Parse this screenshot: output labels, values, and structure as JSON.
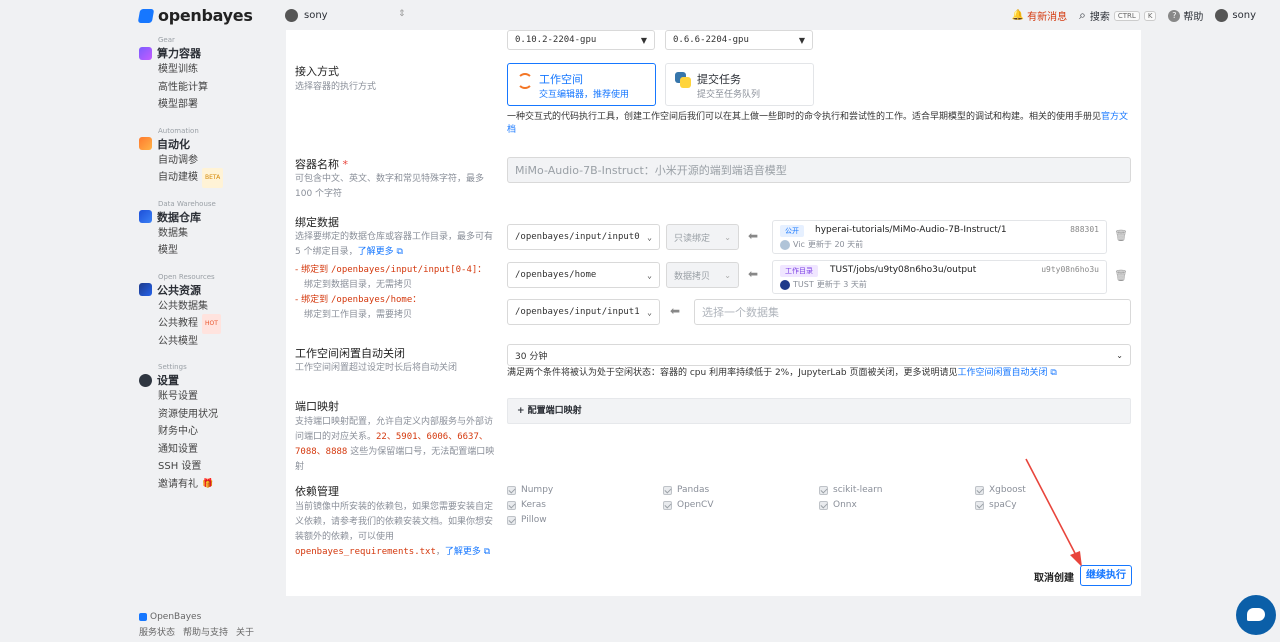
{
  "header": {
    "brand": "openbayes",
    "user": "sony",
    "news_label": "有新消息",
    "search_label": "搜索",
    "kbd": [
      "CTRL",
      "K"
    ],
    "help_label": "帮助",
    "account": "sony"
  },
  "sidebar": {
    "sections": [
      {
        "en": "Gear",
        "title": "算力容器",
        "items": [
          "模型训练",
          "高性能计算",
          "模型部署"
        ]
      },
      {
        "en": "Automation",
        "title": "自动化",
        "items": [
          "自动调参",
          "自动建模"
        ],
        "badge": "BETA"
      },
      {
        "en": "Data Warehouse",
        "title": "数据仓库",
        "items": [
          "数据集",
          "模型"
        ]
      },
      {
        "en": "Open Resources",
        "title": "公共资源",
        "items": [
          "公共数据集",
          "公共教程",
          "公共模型"
        ],
        "badge": "HOT"
      },
      {
        "en": "Settings",
        "title": "设置",
        "items": [
          "账号设置",
          "资源使用状况",
          "财务中心",
          "通知设置",
          "SSH 设置",
          "邀请有礼"
        ]
      }
    ]
  },
  "footer": {
    "brand": "OpenBayes",
    "links": [
      "服务状态",
      "帮助与支持",
      "关于"
    ]
  },
  "form": {
    "image_selects": [
      "0.10.2-2204-gpu",
      "0.6.6-2204-gpu"
    ],
    "access": {
      "label": "接入方式",
      "desc": "选择容器的执行方式",
      "options": [
        {
          "title": "工作空间",
          "sub": "交互编辑器，推荐使用"
        },
        {
          "title": "提交任务",
          "sub": "提交至任务队列"
        }
      ],
      "note": "一种交互式的代码执行工具，创建工作空间后我们可以在其上做一些即时的命令执行和尝试性的工作。适合早期模型的调试和构建。相关的使用手册见",
      "note_link": "官方文档"
    },
    "name": {
      "label": "容器名称",
      "desc": "可包含中文、英文、数字和常见特殊字符，最多 100 个字符",
      "value": "MiMo-Audio-7B-Instruct：小米开源的端到端语音模型"
    },
    "bind": {
      "label": "绑定数据",
      "desc": "选择要绑定的数据仓库或容器工作目录，最多可有 5 个绑定目录，",
      "desc_link": "了解更多",
      "rule1_pre": "- 绑定到 ",
      "rule1_path": "/openbayes/input/input[0-4]",
      "rule1_post": "：",
      "rule1_sub": "绑定到数据目录，无需拷贝",
      "rule2_pre": "- 绑定到 ",
      "rule2_path": "/openbayes/home",
      "rule2_post": "：",
      "rule2_sub": "绑定到工作目录，需要拷贝",
      "rows": [
        {
          "path": "/openbayes/input/input0",
          "mode": "只读绑定",
          "badge": "公开",
          "source": "hyperai-tutorials/MiMo-Audio-7B-Instruct/1",
          "id": "888301",
          "owner": "Vic",
          "updated": "更新于 20 天前"
        },
        {
          "path": "/openbayes/home",
          "mode": "数据拷贝",
          "badge": "工作目录",
          "source": "TUST/jobs/u9ty08n6ho3u/output",
          "id": "u9ty08n6ho3u",
          "owner": "TUST",
          "updated": "更新于 3 天前"
        },
        {
          "path": "/openbayes/input/input1",
          "placeholder": "选择一个数据集"
        }
      ]
    },
    "idle": {
      "label": "工作空间闲置自动关闭",
      "desc": "工作空间闲置超过设定时长后将自动关闭",
      "value": "30 分钟",
      "note": "满足两个条件将被认为处于空闲状态：容器的 cpu 利用率持续低于 2%，JupyterLab 页面被关闭，更多说明请见",
      "note_link": "工作空间闲置自动关闭"
    },
    "ports": {
      "label": "端口映射",
      "desc_pre": "支持端口映射配置，允许自定义内部服务与外部访问端口的对应关系。",
      "reserved": "22、5901、6006、6637、7088、8888",
      "desc_post": " 这些为保留端口号，无法配置端口映射",
      "button": "+ 配置端口映射"
    },
    "deps": {
      "label": "依赖管理",
      "desc": "当前镜像中所安装的依赖包，如果您需要安装自定义依赖，请参考我们的依赖安装文档。如果你想安装额外的依赖，可以使用",
      "file": "openbayes_requirements.txt",
      "link": "了解更多",
      "packages": [
        "Numpy",
        "Pandas",
        "scikit-learn",
        "Xgboost",
        "Keras",
        "OpenCV",
        "Onnx",
        "spaCy",
        "Pillow"
      ]
    },
    "actions": {
      "cancel": "取消创建",
      "continue": "继续执行"
    }
  }
}
